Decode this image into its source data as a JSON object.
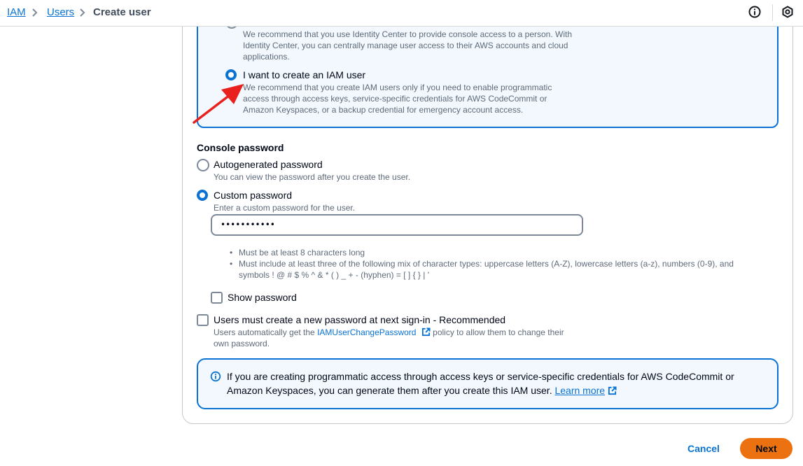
{
  "breadcrumb": {
    "items": [
      "IAM",
      "Users"
    ],
    "current": "Create user"
  },
  "access_option": {
    "desc": "We recommend that you use Identity Center to provide console access to a person. With Identity Center, you can centrally manage user access to their AWS accounts and cloud applications."
  },
  "iam_user_option": {
    "label": "I want to create an IAM user",
    "desc": "We recommend that you create IAM users only if you need to enable programmatic access through access keys, service-specific credentials for AWS CodeCommit or Amazon Keyspaces, or a backup credential for emergency account access."
  },
  "console_password": {
    "title": "Console password",
    "autogenerated": {
      "label": "Autogenerated password",
      "desc": "You can view the password after you create the user."
    },
    "custom": {
      "label": "Custom password",
      "desc": "Enter a custom password for the user."
    },
    "value": "•••••••••••",
    "rules": [
      "Must be at least 8 characters long",
      "Must include at least three of the following mix of character types: uppercase letters (A-Z), lowercase letters (a-z), numbers (0-9), and symbols ! @ # $ % ^ & * ( ) _ + - (hyphen) = [ ] { } | '"
    ],
    "show_password_label": "Show password"
  },
  "reset_option": {
    "label": "Users must create a new password at next sign-in - Recommended",
    "desc_before": "Users automatically get the",
    "link": "IAMUserChangePassword",
    "desc_after": "policy to allow them to change their own password."
  },
  "info": {
    "text": "If you are creating programmatic access through access keys or service-specific credentials for AWS CodeCommit or Amazon Keyspaces, you can generate them after you create this IAM user.",
    "link": "Learn more"
  },
  "buttons": {
    "cancel": "Cancel",
    "next": "Next"
  },
  "icons": {
    "info": "info-icon",
    "settings": "settings-icon",
    "external": "external-link-icon",
    "annotation": "red-arrow-icon"
  },
  "colors": {
    "accent": "#0972d3",
    "primary_button": "#ec7211",
    "annotation": "#e8211f"
  }
}
